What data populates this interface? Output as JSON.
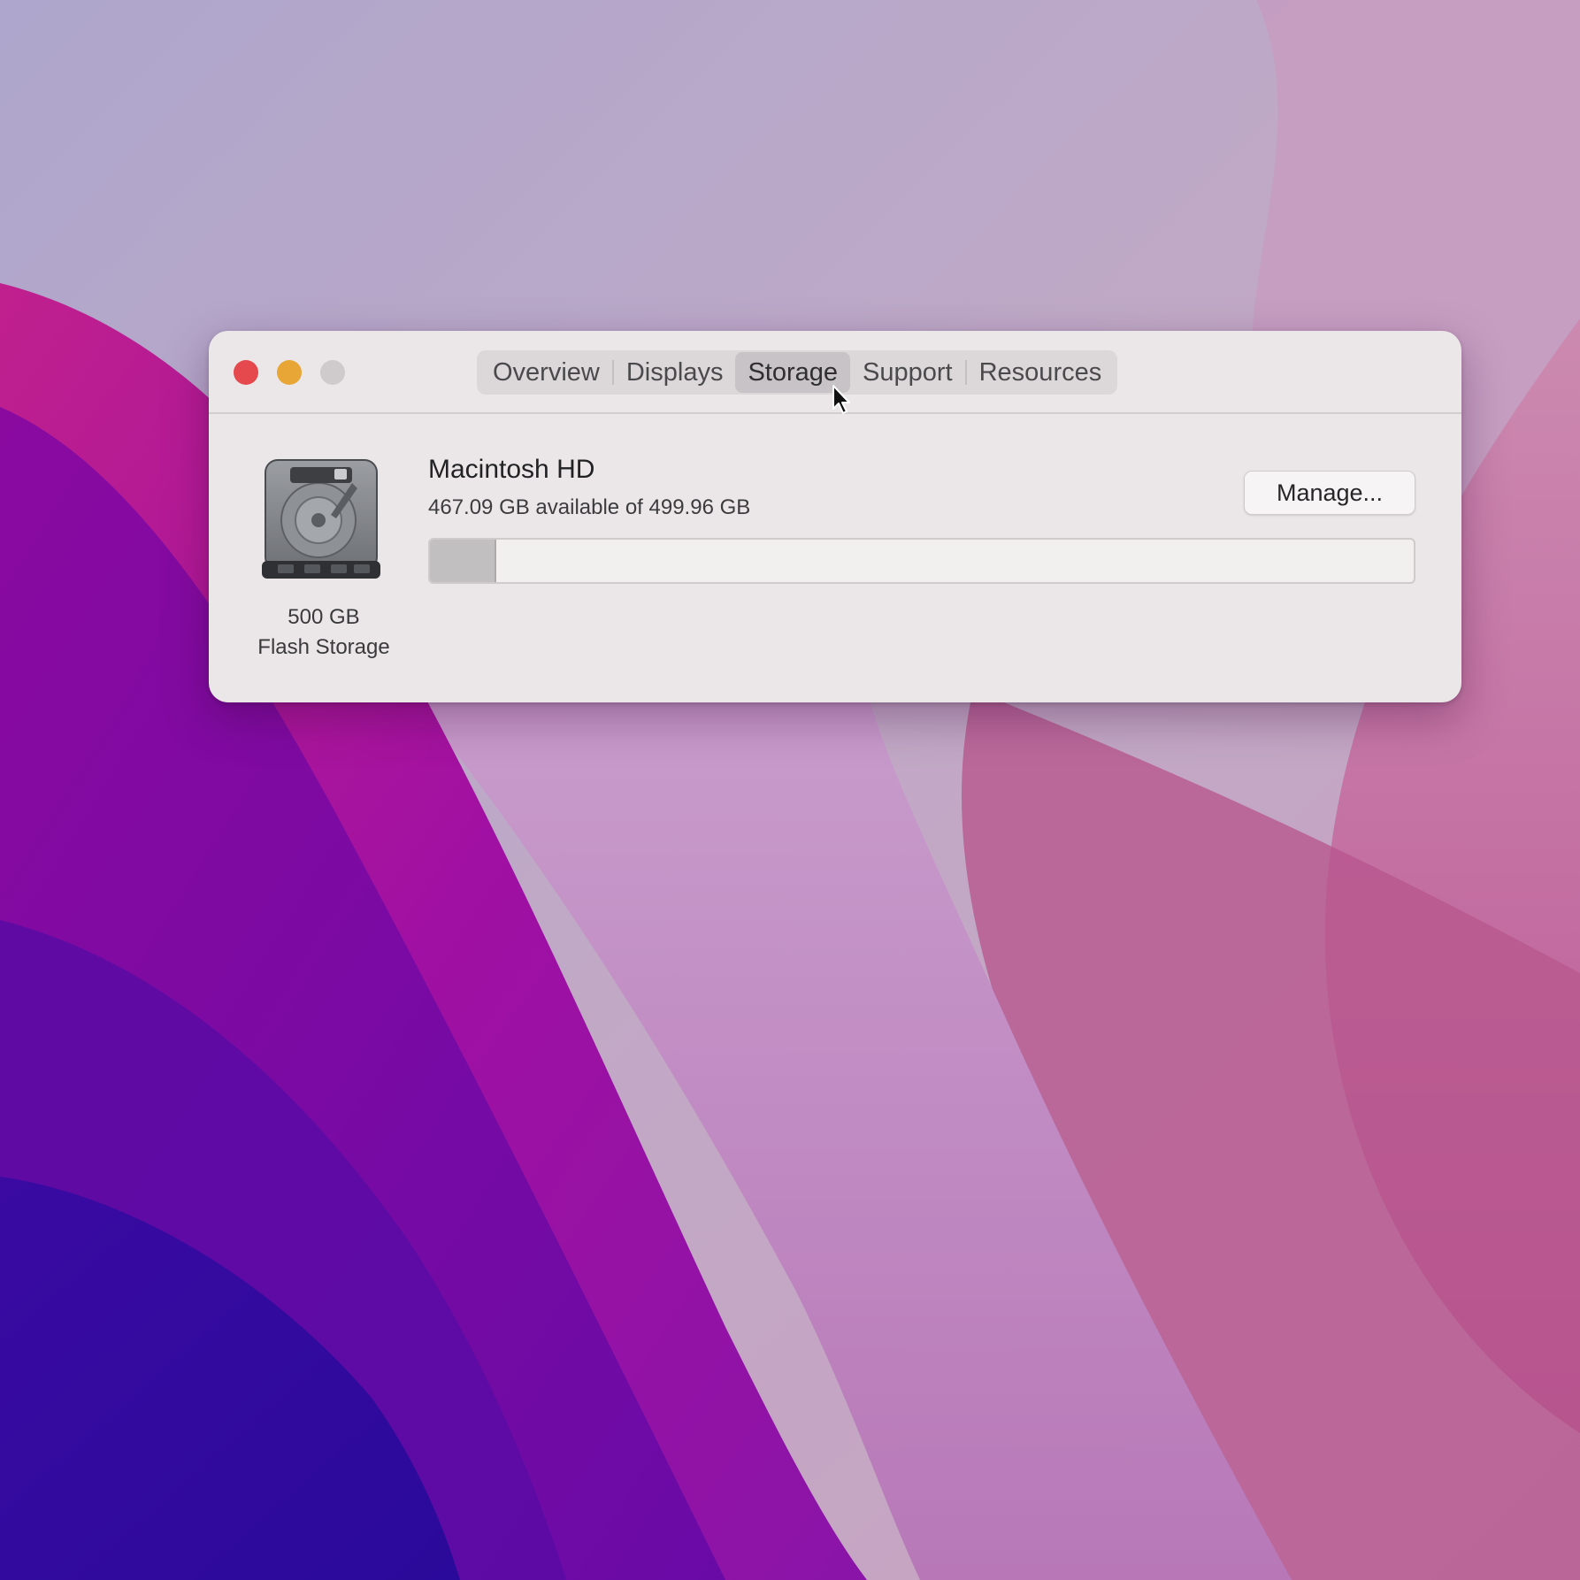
{
  "window": {
    "tabs": [
      {
        "label": "Overview",
        "active": false
      },
      {
        "label": "Displays",
        "active": false
      },
      {
        "label": "Storage",
        "active": true
      },
      {
        "label": "Support",
        "active": false
      },
      {
        "label": "Resources",
        "active": false
      }
    ]
  },
  "storage": {
    "capacity": "500 GB",
    "type": "Flash Storage",
    "volume_name": "Macintosh HD",
    "availability": "467.09 GB available of 499.96 GB",
    "used_fraction": 0.066,
    "manage_label": "Manage..."
  },
  "icons": {
    "disk": "hard-drive-icon",
    "close": "close-button",
    "minimize": "minimize-button",
    "zoom": "zoom-button",
    "cursor": "mouse-pointer-icon"
  },
  "colors": {
    "close": "#e5484d",
    "minimize": "#e7a636",
    "zoom": "#cfcbcd",
    "window_bg": "#ebe7e9"
  }
}
